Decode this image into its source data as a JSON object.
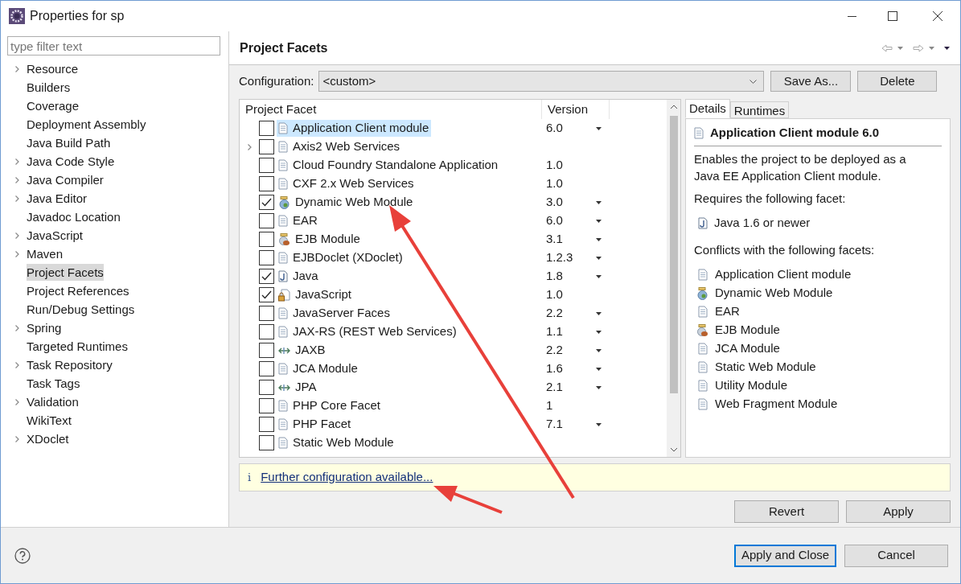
{
  "window": {
    "title": "Properties for sp"
  },
  "filter": {
    "placeholder": "type filter text"
  },
  "sidebar": {
    "items": [
      {
        "label": "Resource",
        "expandable": true,
        "selected": false
      },
      {
        "label": "Builders",
        "expandable": false,
        "selected": false
      },
      {
        "label": "Coverage",
        "expandable": false,
        "selected": false
      },
      {
        "label": "Deployment Assembly",
        "expandable": false,
        "selected": false
      },
      {
        "label": "Java Build Path",
        "expandable": false,
        "selected": false
      },
      {
        "label": "Java Code Style",
        "expandable": true,
        "selected": false
      },
      {
        "label": "Java Compiler",
        "expandable": true,
        "selected": false
      },
      {
        "label": "Java Editor",
        "expandable": true,
        "selected": false
      },
      {
        "label": "Javadoc Location",
        "expandable": false,
        "selected": false
      },
      {
        "label": "JavaScript",
        "expandable": true,
        "selected": false
      },
      {
        "label": "Maven",
        "expandable": true,
        "selected": false
      },
      {
        "label": "Project Facets",
        "expandable": false,
        "selected": true
      },
      {
        "label": "Project References",
        "expandable": false,
        "selected": false
      },
      {
        "label": "Run/Debug Settings",
        "expandable": false,
        "selected": false
      },
      {
        "label": "Spring",
        "expandable": true,
        "selected": false
      },
      {
        "label": "Targeted Runtimes",
        "expandable": false,
        "selected": false
      },
      {
        "label": "Task Repository",
        "expandable": true,
        "selected": false
      },
      {
        "label": "Task Tags",
        "expandable": false,
        "selected": false
      },
      {
        "label": "Validation",
        "expandable": true,
        "selected": false
      },
      {
        "label": "WikiText",
        "expandable": false,
        "selected": false
      },
      {
        "label": "XDoclet",
        "expandable": true,
        "selected": false
      }
    ]
  },
  "page": {
    "title": "Project Facets"
  },
  "configuration": {
    "label": "Configuration:",
    "value": "<custom>",
    "buttons": [
      "Save As...",
      "Delete"
    ]
  },
  "table": {
    "columns": [
      "Project Facet",
      "Version"
    ],
    "rows": [
      {
        "name": "Application Client module",
        "kind": "document",
        "checked": false,
        "selected": true,
        "expandable": false,
        "version": "6.0",
        "has_menu": true
      },
      {
        "name": "Axis2 Web Services",
        "kind": "document",
        "checked": false,
        "selected": false,
        "expandable": true,
        "version": "",
        "has_menu": false
      },
      {
        "name": "Cloud Foundry Standalone Application",
        "kind": "document",
        "checked": false,
        "selected": false,
        "expandable": false,
        "version": "1.0",
        "has_menu": false
      },
      {
        "name": "CXF 2.x Web Services",
        "kind": "document",
        "checked": false,
        "selected": false,
        "expandable": false,
        "version": "1.0",
        "has_menu": false
      },
      {
        "name": "Dynamic Web Module",
        "kind": "web",
        "checked": true,
        "selected": false,
        "expandable": false,
        "version": "3.0",
        "has_menu": true
      },
      {
        "name": "EAR",
        "kind": "document",
        "checked": false,
        "selected": false,
        "expandable": false,
        "version": "6.0",
        "has_menu": true
      },
      {
        "name": "EJB Module",
        "kind": "bean",
        "checked": false,
        "selected": false,
        "expandable": false,
        "version": "3.1",
        "has_menu": true
      },
      {
        "name": "EJBDoclet (XDoclet)",
        "kind": "document",
        "checked": false,
        "selected": false,
        "expandable": false,
        "version": "1.2.3",
        "has_menu": true
      },
      {
        "name": "Java",
        "kind": "java",
        "checked": true,
        "selected": false,
        "expandable": false,
        "version": "1.8",
        "has_menu": true
      },
      {
        "name": "JavaScript",
        "kind": "locked",
        "checked": true,
        "selected": false,
        "expandable": false,
        "version": "1.0",
        "has_menu": false
      },
      {
        "name": "JavaServer Faces",
        "kind": "document",
        "checked": false,
        "selected": false,
        "expandable": false,
        "version": "2.2",
        "has_menu": true
      },
      {
        "name": "JAX-RS (REST Web Services)",
        "kind": "document",
        "checked": false,
        "selected": false,
        "expandable": false,
        "version": "1.1",
        "has_menu": true
      },
      {
        "name": "JAXB",
        "kind": "binding",
        "checked": false,
        "selected": false,
        "expandable": false,
        "version": "2.2",
        "has_menu": true
      },
      {
        "name": "JCA Module",
        "kind": "document",
        "checked": false,
        "selected": false,
        "expandable": false,
        "version": "1.6",
        "has_menu": true
      },
      {
        "name": "JPA",
        "kind": "binding",
        "checked": false,
        "selected": false,
        "expandable": false,
        "version": "2.1",
        "has_menu": true
      },
      {
        "name": "PHP Core Facet",
        "kind": "document",
        "checked": false,
        "selected": false,
        "expandable": false,
        "version": "1",
        "has_menu": false
      },
      {
        "name": "PHP Facet",
        "kind": "document",
        "checked": false,
        "selected": false,
        "expandable": false,
        "version": "7.1",
        "has_menu": true
      },
      {
        "name": "Static Web Module",
        "kind": "document",
        "checked": false,
        "selected": false,
        "expandable": false,
        "version": "",
        "has_menu": false
      }
    ]
  },
  "details": {
    "tabs": [
      {
        "label": "Details",
        "selected": true
      },
      {
        "label": "Runtimes",
        "selected": false
      }
    ],
    "heading": "Application Client module 6.0",
    "description": "Enables the project to be deployed as a Java EE Application Client module.",
    "requires_label": "Requires the following facet:",
    "requires": [
      {
        "name": "Java 1.6 or newer",
        "kind": "java"
      }
    ],
    "conflicts_label": "Conflicts with the following facets:",
    "conflicts": [
      {
        "name": "Application Client module",
        "kind": "document"
      },
      {
        "name": "Dynamic Web Module",
        "kind": "web"
      },
      {
        "name": "EAR",
        "kind": "document"
      },
      {
        "name": "EJB Module",
        "kind": "bean"
      },
      {
        "name": "JCA Module",
        "kind": "document"
      },
      {
        "name": "Static Web Module",
        "kind": "document"
      },
      {
        "name": "Utility Module",
        "kind": "document"
      },
      {
        "name": "Web Fragment Module",
        "kind": "document"
      }
    ]
  },
  "info": {
    "icon": "i",
    "link": "Further configuration available..."
  },
  "page_buttons": [
    "Revert",
    "Apply"
  ],
  "dialog_buttons": [
    {
      "label": "Apply and Close",
      "default": true
    },
    {
      "label": "Cancel",
      "default": false
    }
  ]
}
